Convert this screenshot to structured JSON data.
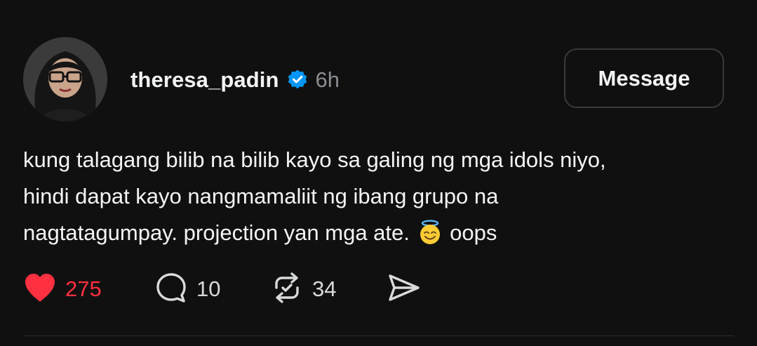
{
  "post": {
    "username": "theresa_padin",
    "timestamp": "6h",
    "verified": true,
    "message_button": "Message",
    "body_lines": [
      "kung talagang bilib na bilib kayo sa galing ng mga idols niyo,",
      "hindi dapat kayo nangmamaliit ng ibang grupo na",
      "nagtatagumpay. projection yan mga ate.",
      "oops"
    ],
    "emoji": "smiling-face-with-halo"
  },
  "actions": {
    "likes": "275",
    "comments": "10",
    "reposts": "34"
  },
  "colors": {
    "background": "#101010",
    "text": "#f3f5f7",
    "muted": "#8a8d91",
    "like_red": "#ff3040",
    "verified_blue": "#0095f6"
  },
  "icons": [
    "heart-icon",
    "comment-icon",
    "repost-icon",
    "share-icon",
    "verified-badge-icon"
  ]
}
